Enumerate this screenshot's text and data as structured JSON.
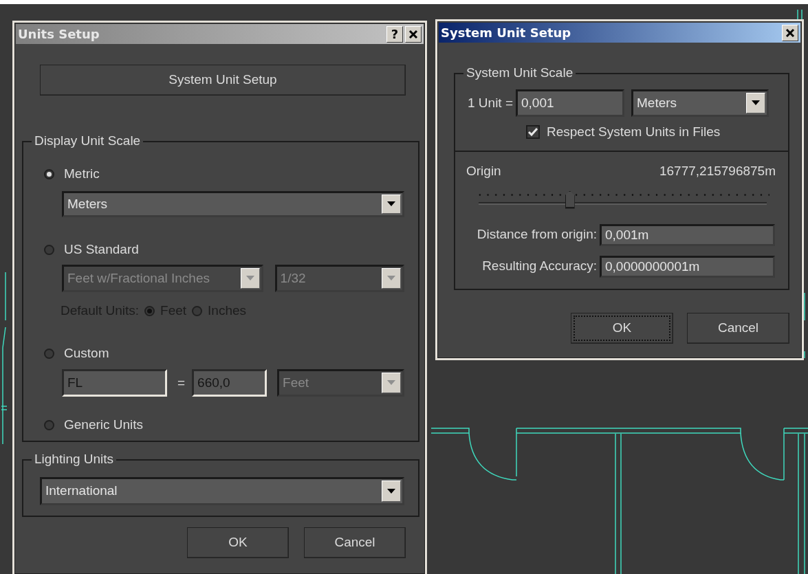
{
  "units_setup": {
    "title": "Units Setup",
    "active": false,
    "help_button": "?",
    "system_unit_setup_button": "System Unit Setup",
    "display_unit_scale": {
      "label": "Display Unit Scale",
      "options": [
        {
          "kind": "metric",
          "label": "Metric",
          "selected": true,
          "dropdown": {
            "value": "Meters",
            "disabled": false
          }
        },
        {
          "kind": "us",
          "label": "US Standard",
          "selected": false,
          "dropdowns": [
            {
              "value": "Feet w/Fractional Inches",
              "disabled": true
            },
            {
              "value": "1/32",
              "disabled": true
            }
          ],
          "default_units_label": "Default Units:",
          "default_units": [
            {
              "label": "Feet",
              "selected": true
            },
            {
              "label": "Inches",
              "selected": false
            }
          ]
        },
        {
          "kind": "custom",
          "label": "Custom",
          "selected": false,
          "name": "FL",
          "equals": "=",
          "value": "660,0",
          "disabled": true,
          "dropdown": {
            "value": "Feet",
            "disabled": true
          }
        },
        {
          "kind": "generic",
          "label": "Generic Units",
          "selected": false
        }
      ]
    },
    "lighting_units": {
      "label": "Lighting Units",
      "dropdown": {
        "value": "International",
        "disabled": false
      }
    },
    "buttons": [
      {
        "label": "OK",
        "focused": false
      },
      {
        "label": "Cancel",
        "focused": false
      }
    ]
  },
  "system_unit_setup": {
    "title": "System Unit Setup",
    "active": true,
    "scale": {
      "label": "System Unit Scale",
      "unit_label": "1 Unit =",
      "value": "0,001",
      "unit": {
        "value": "Meters",
        "disabled": false
      },
      "respect": {
        "label": "Respect System Units in Files",
        "checked": true
      }
    },
    "origin": {
      "label": "Origin",
      "reading": "16777,215796875m",
      "level": 0.32
    },
    "fields": [
      {
        "label": "Distance from origin:",
        "value": "0,001m"
      },
      {
        "label": "Resulting Accuracy:",
        "value": "0,0000000001m"
      }
    ],
    "buttons": [
      {
        "label": "OK",
        "focused": true
      },
      {
        "label": "Cancel",
        "focused": false
      }
    ]
  }
}
